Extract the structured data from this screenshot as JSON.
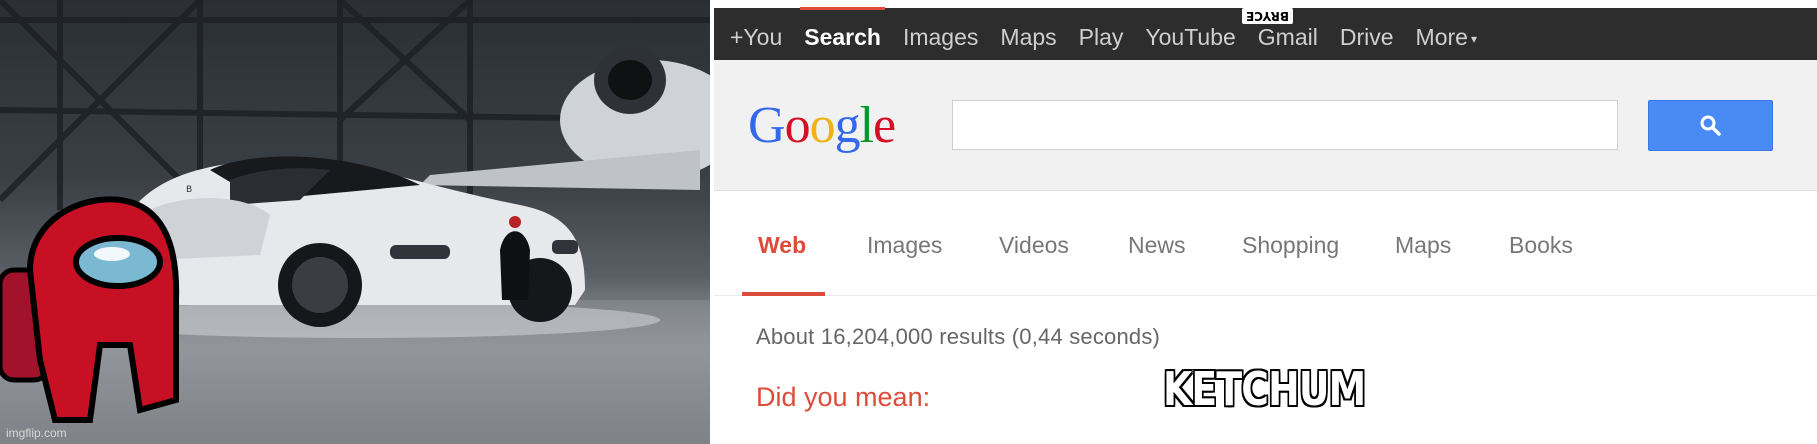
{
  "photo": {
    "watermark": "imgflip.com",
    "car_badge": "B"
  },
  "topbar": {
    "items": [
      {
        "label": "+You",
        "active": false
      },
      {
        "label": "Search",
        "active": true
      },
      {
        "label": "Images",
        "active": false
      },
      {
        "label": "Maps",
        "active": false
      },
      {
        "label": "Play",
        "active": false
      },
      {
        "label": "YouTube",
        "active": false
      },
      {
        "label": "Gmail",
        "active": false
      },
      {
        "label": "Drive",
        "active": false
      },
      {
        "label": "More",
        "active": false
      }
    ],
    "more_caret": "▾",
    "sticker": "BRYCE"
  },
  "search": {
    "logo_letters": [
      {
        "ch": "G",
        "color": "#3369e8"
      },
      {
        "ch": "o",
        "color": "#d50f25"
      },
      {
        "ch": "o",
        "color": "#eeb211"
      },
      {
        "ch": "g",
        "color": "#3369e8"
      },
      {
        "ch": "l",
        "color": "#009925"
      },
      {
        "ch": "e",
        "color": "#d50f25"
      }
    ],
    "query": "",
    "button_icon": "search-icon"
  },
  "tabs": {
    "items": [
      {
        "label": "Web",
        "active": true
      },
      {
        "label": "Images",
        "active": false
      },
      {
        "label": "Videos",
        "active": false
      },
      {
        "label": "News",
        "active": false
      },
      {
        "label": "Shopping",
        "active": false
      },
      {
        "label": "Maps",
        "active": false
      },
      {
        "label": "Books",
        "active": false
      }
    ]
  },
  "results": {
    "stats": "About 16,204,000 results (0,44 seconds)",
    "did_you_mean": "Did you mean:",
    "suggestion": "KETCHUM"
  },
  "colors": {
    "accent_red": "#dd4b39",
    "topbar_bg": "#2d2d2d",
    "search_button": "#4a8af4"
  }
}
